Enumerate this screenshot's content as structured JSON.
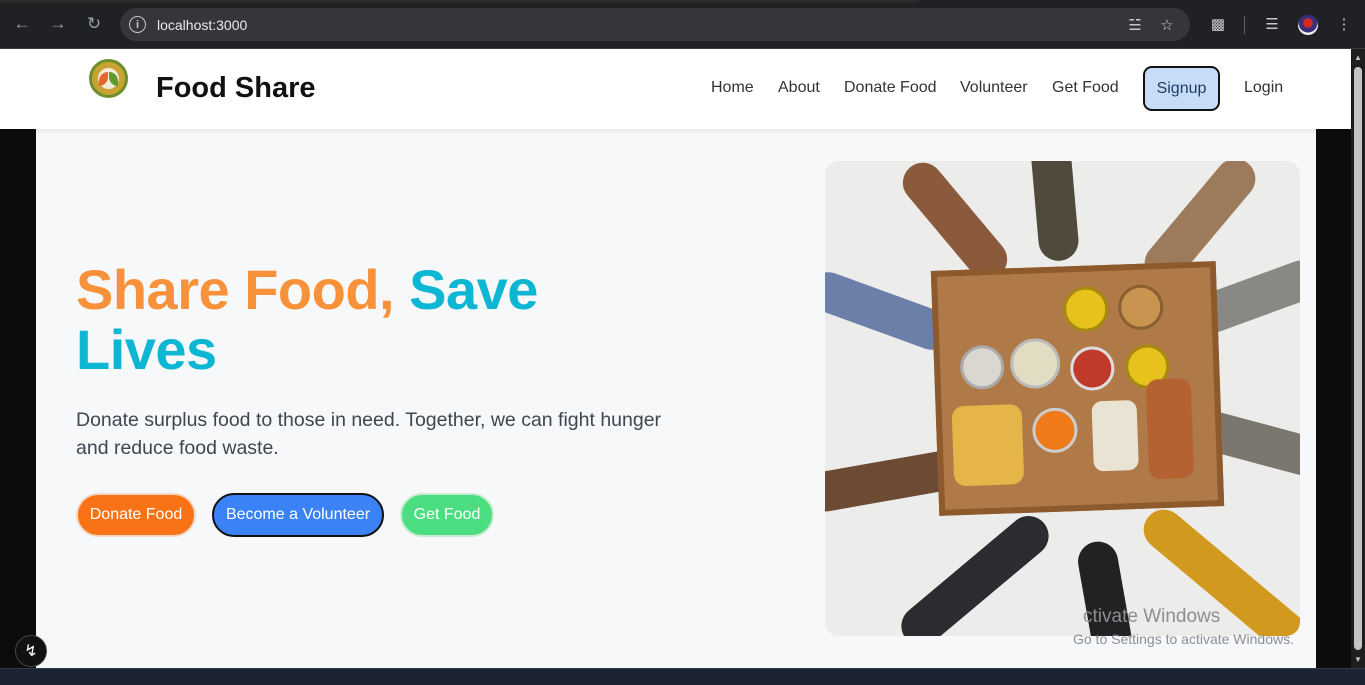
{
  "browser": {
    "url": "localhost:3000",
    "icons": [
      "back-icon",
      "forward-icon",
      "reload-icon",
      "site-info-icon",
      "translate-icon",
      "bookmark-star-icon",
      "extensions-icon",
      "media-controls-icon",
      "profile-avatar",
      "more-menu-icon"
    ]
  },
  "header": {
    "brand": "Food Share",
    "nav": {
      "home": "Home",
      "about": "About",
      "donate": "Donate Food",
      "volunteer": "Volunteer",
      "get_food": "Get Food",
      "signup": "Signup",
      "login": "Login"
    }
  },
  "hero": {
    "headline_part1": "Share Food,",
    "headline_part2": "Save Lives",
    "tagline": "Donate surplus food to those in need. Together, we can fight hunger and reduce food waste.",
    "buttons": {
      "donate": "Donate Food",
      "volunteer": "Become a Volunteer",
      "get_food": "Get Food"
    }
  },
  "watermark": {
    "line1": "ctivate Windows",
    "line2": "Go to Settings to activate Windows."
  },
  "colors": {
    "orange": "#f7923a",
    "teal": "#0db6d3",
    "donate_btn": "#f97316",
    "volunteer_btn": "#3b82f6",
    "getfood_btn": "#4ade80",
    "signup_bg": "#c7dcf9"
  }
}
